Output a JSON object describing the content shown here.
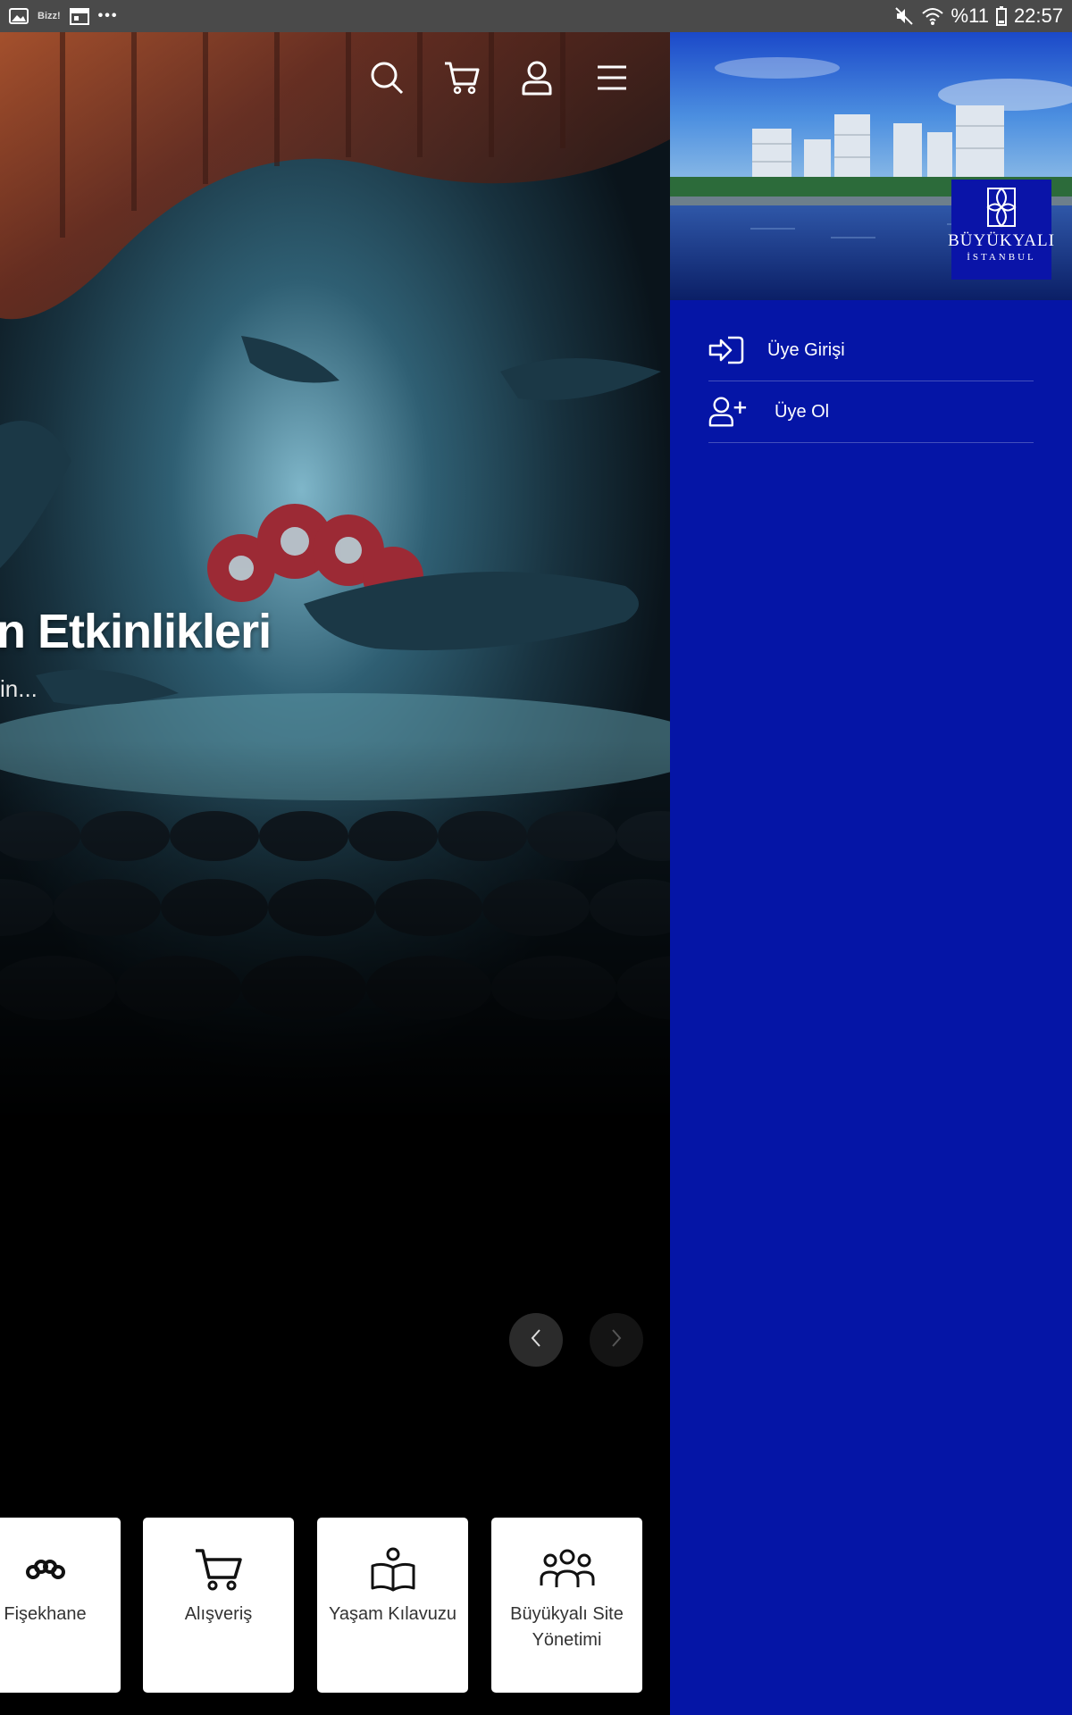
{
  "status_bar": {
    "bizz_label": "Bizz!",
    "battery": "%11",
    "time": "22:57"
  },
  "hero": {
    "title": "n Etkinlikleri",
    "subtitle": "in..."
  },
  "tiles": [
    {
      "label": "Fişekhane",
      "icon": "fisekhane-logo-icon"
    },
    {
      "label": "Alışveriş",
      "icon": "cart-icon"
    },
    {
      "label": "Yaşam Kılavuzu",
      "icon": "book-reader-icon"
    },
    {
      "label": "Büyükyalı Site Yönetimi",
      "icon": "users-group-icon"
    }
  ],
  "side_panel": {
    "logo_title": "BÜYÜKYALI",
    "logo_subtitle": "İSTANBUL",
    "menu": [
      {
        "label": "Üye Girişi",
        "icon": "sign-in-icon"
      },
      {
        "label": "Üye Ol",
        "icon": "user-plus-icon"
      }
    ]
  },
  "colors": {
    "panel_bg": "#0515a6",
    "status_bar": "#4a4a4a"
  }
}
